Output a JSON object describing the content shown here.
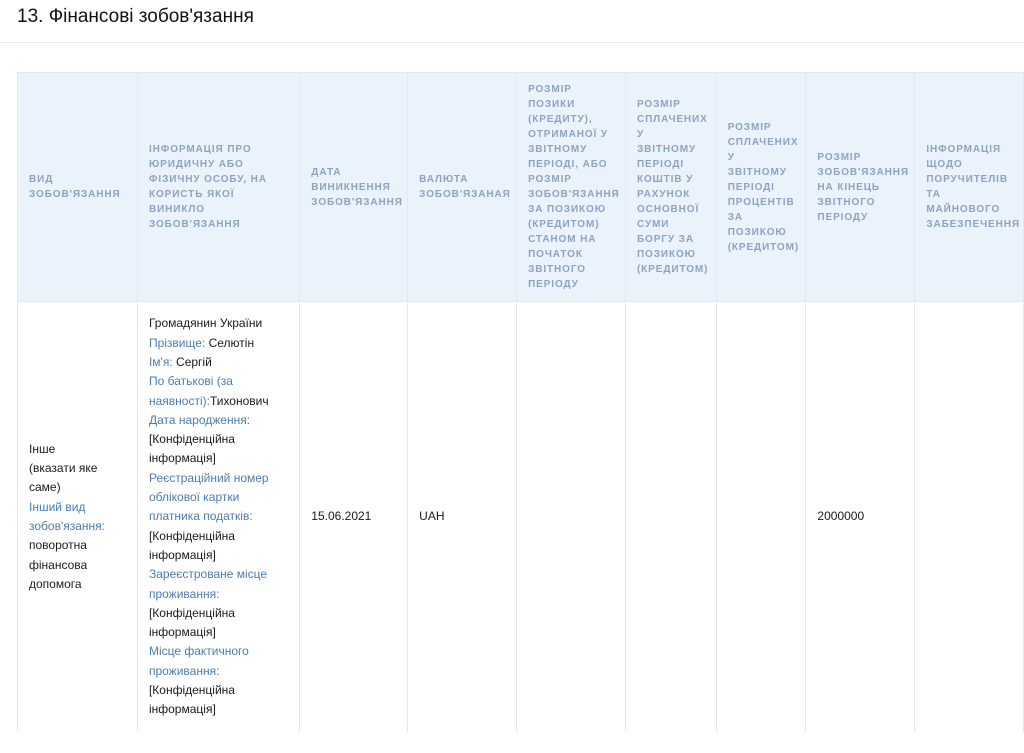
{
  "section": {
    "title": "13. Фінансові зобов'язання"
  },
  "table": {
    "headers": [
      "Вид зобов'язання",
      "Інформація про юридичну або фізичну особу, на користь якої виникло зобов'язання",
      "Дата виникнення зобов'язання",
      "Валюта зобов'язаная",
      "Розмір позики (кредиту), отриманої у звітному періоді, або розмір зобов'язання за позикою (кредитом) станом на початок звітного періоду",
      "Розмір сплачених у звітному періоді коштів у рахунок основної суми боргу за позикою (кредитом)",
      "Розмір сплачених у звітному періоді процентів за позикою (кредитом)",
      "Розмір зобов'язання на кінець звітного періоду",
      "Інформація щодо поручителів та майнового забезпечення"
    ],
    "row": {
      "type": {
        "line1": "Інше",
        "line2": "(вказати яке",
        "line3": "саме)",
        "other_label": "Інший вид зобов'язання:",
        "other_value": " поворотна фінансова допомога"
      },
      "person": {
        "status": "Громадянин України",
        "surname_label": "Прізвище:",
        "surname_value": " Селютін",
        "name_label": "Ім'я:",
        "name_value": " Сергій",
        "patronymic_label": "По батькові (за наявності):",
        "patronymic_value": "Тихонович",
        "birth_label": "Дата народження:",
        "birth_value": "[Конфіденційна інформація]",
        "tax_label": "Реєстраційний номер облікової картки платника податків:",
        "tax_value": "[Конфіденційна інформація]",
        "reg_label": "Зареєстроване місце проживання:",
        "reg_value": "[Конфіденційна інформація]",
        "actual_label": "Місце фактичного проживання:",
        "actual_value": "[Конфіденційна інформація]"
      },
      "date": "15.06.2021",
      "currency": "UAH",
      "loan_amount": "",
      "principal_paid": "",
      "interest_paid": "",
      "end_amount": "2000000",
      "guarantors": ""
    }
  }
}
